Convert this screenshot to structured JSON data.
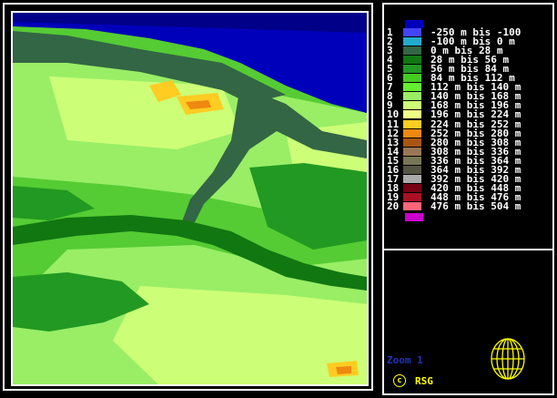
{
  "legend": {
    "top_swatch_color": "#0000bb",
    "bottom_swatch_color": "#cc00cc",
    "items": [
      {
        "num": "1",
        "label": "-250 m bis -100",
        "color": "#4444ff"
      },
      {
        "num": "2",
        "label": "-100 m bis 0 m",
        "color": "#22aacc"
      },
      {
        "num": "3",
        "label": "0 m bis 28 m",
        "color": "#336644"
      },
      {
        "num": "4",
        "label": "28 m bis 56 m",
        "color": "#117711"
      },
      {
        "num": "5",
        "label": "56 m bis 84 m",
        "color": "#229922"
      },
      {
        "num": "6",
        "label": "84 m bis 112 m",
        "color": "#44cc22"
      },
      {
        "num": "7",
        "label": "112 m bis 140 m",
        "color": "#66ee33"
      },
      {
        "num": "8",
        "label": "140 m bis 168 m",
        "color": "#99ee66"
      },
      {
        "num": "9",
        "label": "168 m bis 196 m",
        "color": "#ccff77"
      },
      {
        "num": "10",
        "label": "196 m bis 224 m",
        "color": "#eeff88"
      },
      {
        "num": "11",
        "label": "224 m bis 252 m",
        "color": "#ffcc22"
      },
      {
        "num": "12",
        "label": "252 m bis 280 m",
        "color": "#ee8811"
      },
      {
        "num": "13",
        "label": "280 m bis 308 m",
        "color": "#aa5511"
      },
      {
        "num": "14",
        "label": "308 m bis 336 m",
        "color": "#997755"
      },
      {
        "num": "15",
        "label": "336 m bis 364 m",
        "color": "#777755"
      },
      {
        "num": "16",
        "label": "364 m bis 392 m",
        "color": "#555544"
      },
      {
        "num": "17",
        "label": "392 m bis 420 m",
        "color": "#aaaaaa"
      },
      {
        "num": "18",
        "label": "420 m bis 448 m",
        "color": "#770011"
      },
      {
        "num": "19",
        "label": "448 m bis 476 m",
        "color": "#aa1122"
      },
      {
        "num": "20",
        "label": "476 m bis 504 m",
        "color": "#ff6677"
      }
    ]
  },
  "zoom_label": "Zoom 1",
  "copyright_symbol": "c",
  "copyright_text": "RSG",
  "globe_color": "#ffff00"
}
